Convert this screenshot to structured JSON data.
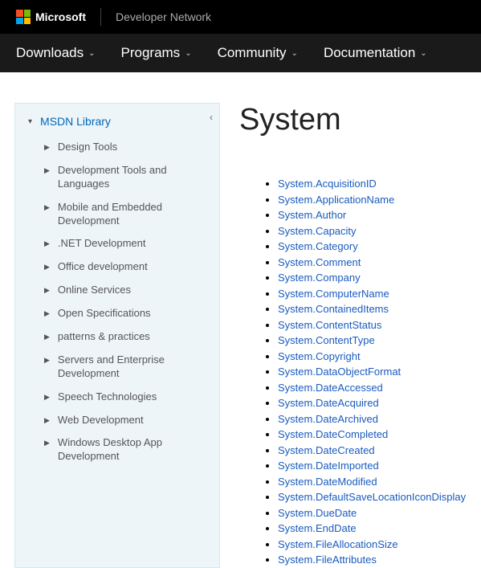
{
  "header": {
    "brand": "Microsoft",
    "network": "Developer Network"
  },
  "nav": [
    "Downloads",
    "Programs",
    "Community",
    "Documentation"
  ],
  "sidebar": {
    "title": "MSDN Library",
    "items": [
      "Design Tools",
      "Development Tools and Languages",
      "Mobile and Embedded Development",
      ".NET Development",
      "Office development",
      "Online Services",
      "Open Specifications",
      "patterns & practices",
      "Servers and Enterprise Development",
      "Speech Technologies",
      "Web Development",
      "Windows Desktop App Development"
    ]
  },
  "page": {
    "title": "System",
    "properties": [
      "System.AcquisitionID",
      "System.ApplicationName",
      "System.Author",
      "System.Capacity",
      "System.Category",
      "System.Comment",
      "System.Company",
      "System.ComputerName",
      "System.ContainedItems",
      "System.ContentStatus",
      "System.ContentType",
      "System.Copyright",
      "System.DataObjectFormat",
      "System.DateAccessed",
      "System.DateAcquired",
      "System.DateArchived",
      "System.DateCompleted",
      "System.DateCreated",
      "System.DateImported",
      "System.DateModified",
      "System.DefaultSaveLocationIconDisplay",
      "System.DueDate",
      "System.EndDate",
      "System.FileAllocationSize",
      "System.FileAttributes"
    ]
  }
}
